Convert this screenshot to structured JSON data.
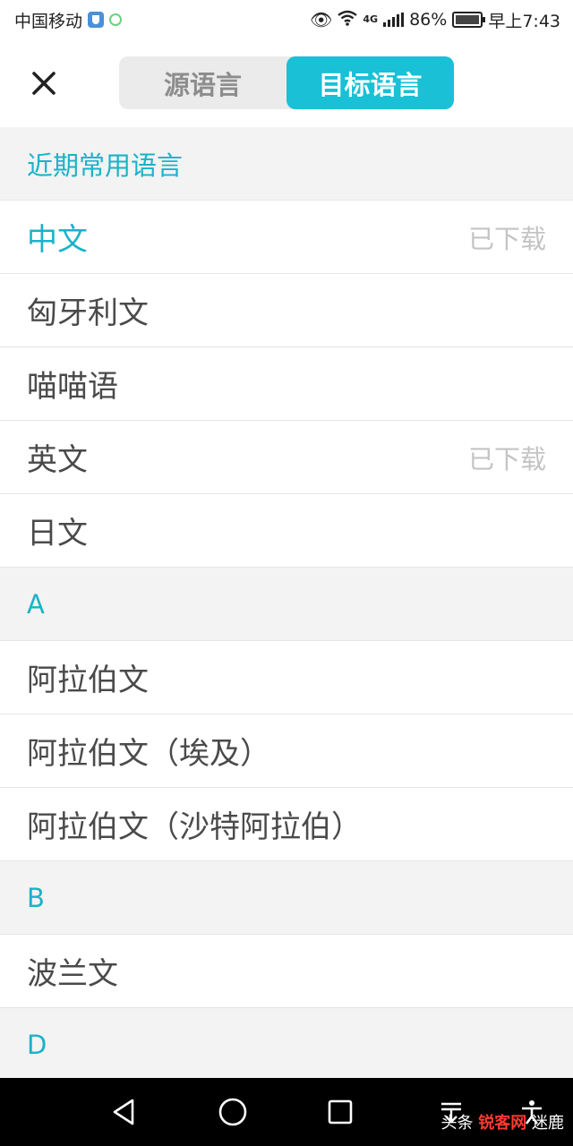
{
  "status_bar": {
    "carrier": "中国移动",
    "network": "4G",
    "battery": "86%",
    "time": "早上7:43"
  },
  "header": {
    "close_icon": "close-icon",
    "tabs": [
      {
        "label": "源语言",
        "active": false
      },
      {
        "label": "目标语言",
        "active": true
      }
    ]
  },
  "list": {
    "recent_header": "近期常用语言",
    "recent": [
      {
        "name": "中文",
        "status": "已下载",
        "current": true
      },
      {
        "name": "匈牙利文",
        "status": ""
      },
      {
        "name": "喵喵语",
        "status": ""
      },
      {
        "name": "英文",
        "status": "已下载"
      },
      {
        "name": "日文",
        "status": ""
      }
    ],
    "section_a": "A",
    "a_items": [
      {
        "name": "阿拉伯文"
      },
      {
        "name": "阿拉伯文（埃及）"
      },
      {
        "name": "阿拉伯文（沙特阿拉伯）"
      }
    ],
    "section_b": "B",
    "b_items": [
      {
        "name": "波兰文"
      }
    ],
    "section_d": "D"
  },
  "nav": {
    "back_icon": "back-triangle-icon",
    "home_icon": "home-circle-icon",
    "recents_icon": "recents-square-icon"
  },
  "watermark": {
    "prefix": "头条",
    "brand": "锐客网",
    "suffix": "迷鹿"
  },
  "colors": {
    "accent": "#19c0d6",
    "section_bg": "#f3f3f3",
    "tab_bg": "#ebebeb"
  }
}
